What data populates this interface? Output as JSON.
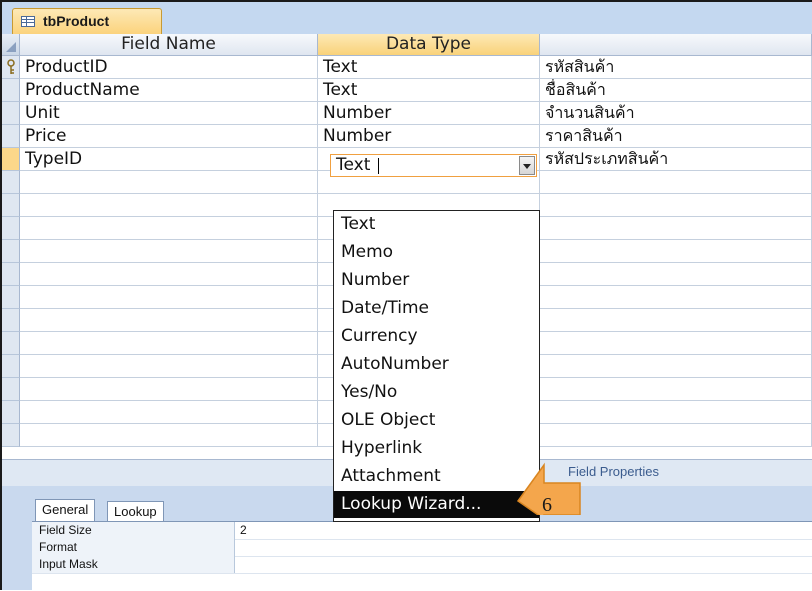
{
  "tab": {
    "label": "tbProduct"
  },
  "columns": {
    "field_name": "Field Name",
    "data_type": "Data Type",
    "description": ""
  },
  "rows": [
    {
      "field_name": "ProductID",
      "data_type": "Text",
      "description": "รหัสสินค้า",
      "primary_key": true
    },
    {
      "field_name": "ProductName",
      "data_type": "Text",
      "description": "ชื่อสินค้า",
      "primary_key": false
    },
    {
      "field_name": "Unit",
      "data_type": "Number",
      "description": "จำนวนสินค้า",
      "primary_key": false
    },
    {
      "field_name": "Price",
      "data_type": "Number",
      "description": "ราคาสินค้า",
      "primary_key": false
    },
    {
      "field_name": "TypeID",
      "data_type": "Text",
      "description": "รหัสประเภทสินค้า",
      "primary_key": false
    }
  ],
  "dropdown": {
    "selected": "Text",
    "options": [
      "Text",
      "Memo",
      "Number",
      "Date/Time",
      "Currency",
      "AutoNumber",
      "Yes/No",
      "OLE Object",
      "Hyperlink",
      "Attachment",
      "Lookup Wizard..."
    ],
    "highlighted": "Lookup Wizard..."
  },
  "field_properties": {
    "label": "Field Properties"
  },
  "property_tabs": [
    "General",
    "Lookup"
  ],
  "properties": [
    {
      "label": "Field Size",
      "value": "2"
    },
    {
      "label": "Format",
      "value": ""
    },
    {
      "label": "Input Mask",
      "value": ""
    }
  ],
  "callout": {
    "text": "6",
    "color": "#f4a64c"
  },
  "colors": {
    "tab_active": "#fbd27a",
    "header_selected": "#f9d27a",
    "frame_bg": "#c4d8f0",
    "highlight": "#0a0a0a"
  }
}
